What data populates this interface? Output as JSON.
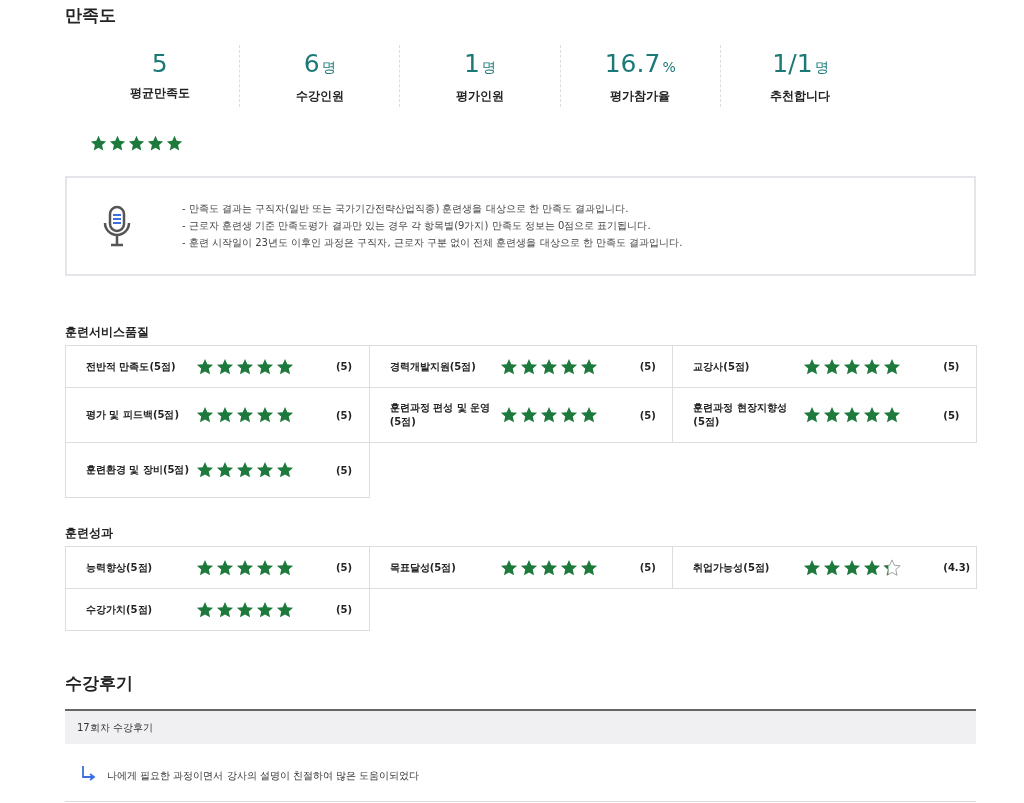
{
  "title": "만족도",
  "stats": [
    {
      "value": "5",
      "label": "평균만족도"
    },
    {
      "value": "6",
      "unit": "명",
      "label": "수강인원"
    },
    {
      "value": "1",
      "unit": "명",
      "label": "평가인원"
    },
    {
      "value": "16.7",
      "unit": "%",
      "label": "평가참가율"
    },
    {
      "value": "1/1",
      "unit": "명",
      "label": "추천합니다"
    }
  ],
  "overall": {
    "stars": 5
  },
  "notice": [
    "- 만족도 결과는 구직자(일반 또는 국가기간전략산업직종) 훈련생을 대상으로 한 만족도 결과입니다.",
    "- 근로자 훈련생 기준 만족도평가 결과만 있는 경우 각 항목별(9가지) 만족도 정보는 0점으로 표기됩니다.",
    "- 훈련 시작일이 23년도 이후인 과정은 구직자, 근로자 구분 없이 전체 훈련생을 대상으로 한 만족도 결과입니다."
  ],
  "sections": [
    {
      "title": "훈련서비스품질",
      "items": [
        {
          "label": "전반적 만족도(5점)",
          "stars": 5,
          "score": "(5)"
        },
        {
          "label": "경력개발지원(5점)",
          "stars": 5,
          "score": "(5)"
        },
        {
          "label": "교강사(5점)",
          "stars": 5,
          "score": "(5)"
        },
        {
          "label": "평가 및 피드백(5점)",
          "stars": 5,
          "score": "(5)"
        },
        {
          "label": "훈련과정 편성 및 운영(5점)",
          "stars": 5,
          "score": "(5)"
        },
        {
          "label": "훈련과정 현장지향성(5점)",
          "stars": 5,
          "score": "(5)"
        },
        {
          "label": "훈련환경 및 장비(5점)",
          "stars": 5,
          "score": "(5)"
        }
      ]
    },
    {
      "title": "훈련성과",
      "items": [
        {
          "label": "능력향상(5점)",
          "stars": 5,
          "score": "(5)"
        },
        {
          "label": "목표달성(5점)",
          "stars": 5,
          "score": "(5)"
        },
        {
          "label": "취업가능성(5점)",
          "stars": 4.3,
          "score": "(4.3)"
        },
        {
          "label": "수강가치(5점)",
          "stars": 5,
          "score": "(5)"
        }
      ]
    }
  ],
  "reviews": {
    "title": "수강후기",
    "items": [
      {
        "header": "17회차 수강후기",
        "text": "나에게 필요한 과정이면서 강사의 설명이 친절하여 많은 도움이되었다"
      }
    ]
  }
}
